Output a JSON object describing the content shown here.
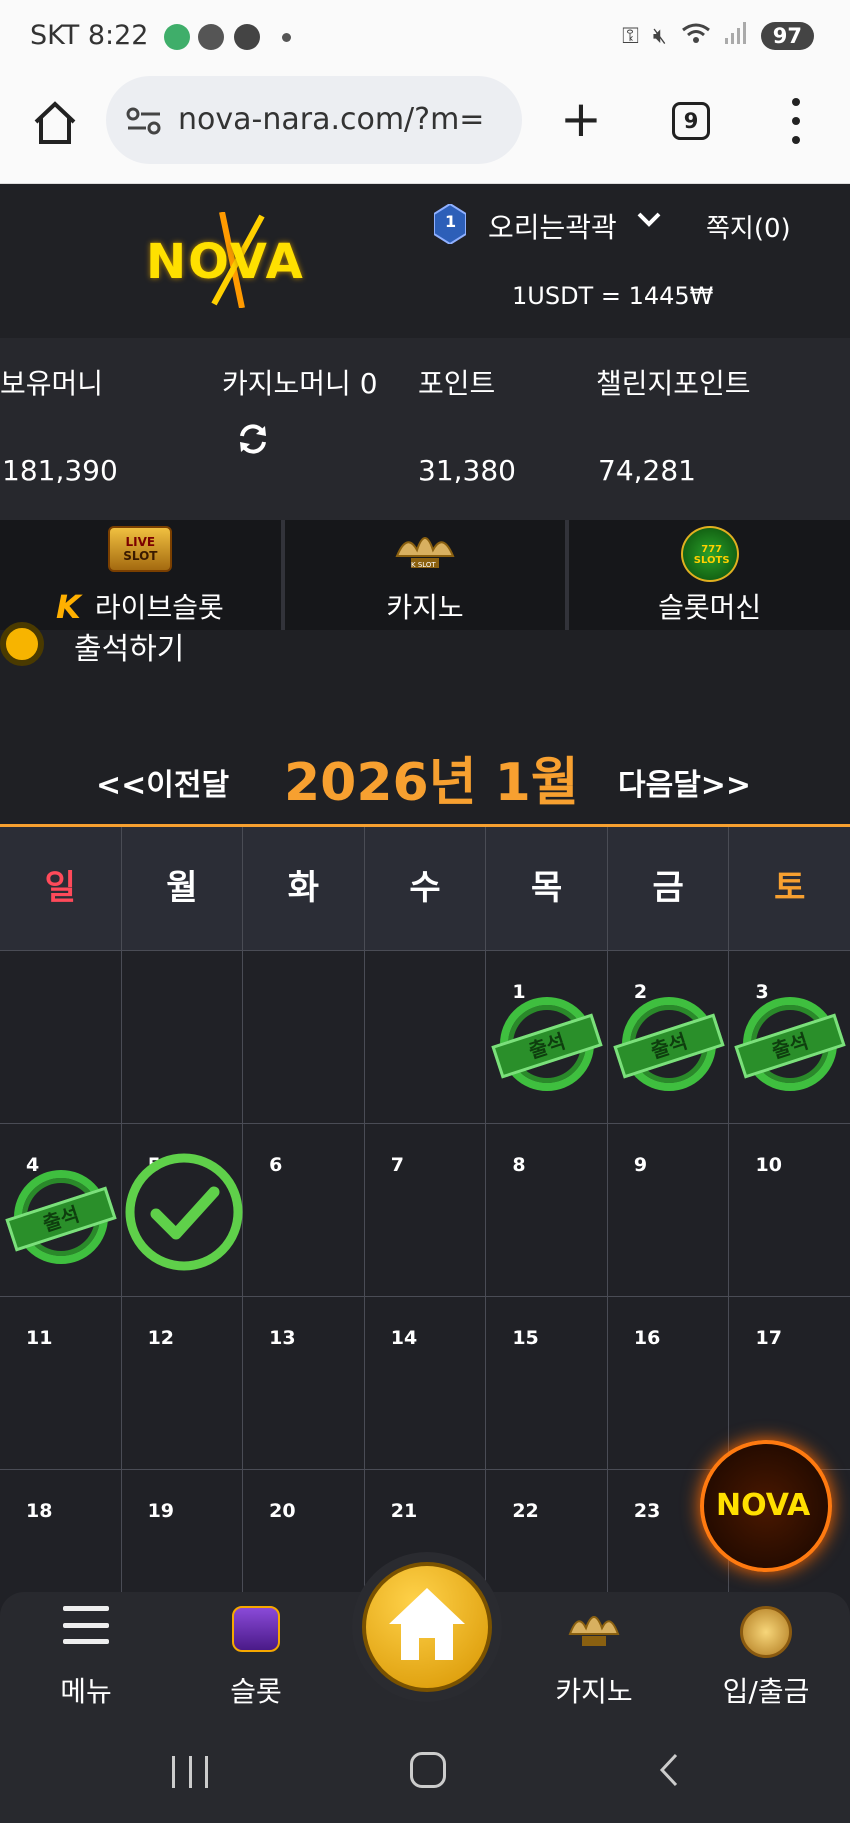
{
  "status_bar": {
    "time": "SKT 8:22",
    "battery": "97"
  },
  "browser": {
    "url": "nova-nara.com/?m=",
    "tab_count": "9"
  },
  "header": {
    "logo_text": "NOVA",
    "level": "1",
    "username": "오리는곽곽",
    "messages": "쪽지(0)",
    "exchange_rate": "1USDT = 1445₩"
  },
  "balances": {
    "money_label": "보유머니",
    "money_value": "181,390",
    "casino_label": "카지노머니 0",
    "points_label": "포인트",
    "points_value": "31,380",
    "challenge_label": "챌린지포인트",
    "challenge_value": "74,281"
  },
  "game_tabs": [
    {
      "label": "라이브슬롯",
      "icon_text_1": "LIVE",
      "icon_text_2": "SLOT"
    },
    {
      "label": "카지노",
      "icon_text": "K SLOT"
    },
    {
      "label": "슬롯머신",
      "icon_text": "777 SLOTS"
    }
  ],
  "attendance": {
    "title": "출석하기"
  },
  "calendar": {
    "prev": "<<이전달",
    "title": "2026년 1월",
    "next": "다음달>>",
    "weekdays": [
      "일",
      "월",
      "화",
      "수",
      "목",
      "금",
      "토"
    ],
    "weekday_colors": [
      "#ff4a5a",
      "#ffffff",
      "#ffffff",
      "#ffffff",
      "#ffffff",
      "#ffffff",
      "#f7a030"
    ],
    "stamp_label": "출석",
    "weeks": [
      [
        "",
        "",
        "",
        "",
        "1",
        "2",
        "3"
      ],
      [
        "4",
        "5",
        "6",
        "7",
        "8",
        "9",
        "10"
      ],
      [
        "11",
        "12",
        "13",
        "14",
        "15",
        "16",
        "17"
      ],
      [
        "18",
        "19",
        "20",
        "21",
        "22",
        "23",
        ""
      ]
    ],
    "stamped_days": [
      "1",
      "2",
      "3",
      "4"
    ],
    "checked_today": "5"
  },
  "float_logo": "NOVA",
  "bottom_nav": {
    "menu": "메뉴",
    "slot": "슬롯",
    "casino": "카지노",
    "deposit": "입/출금"
  }
}
